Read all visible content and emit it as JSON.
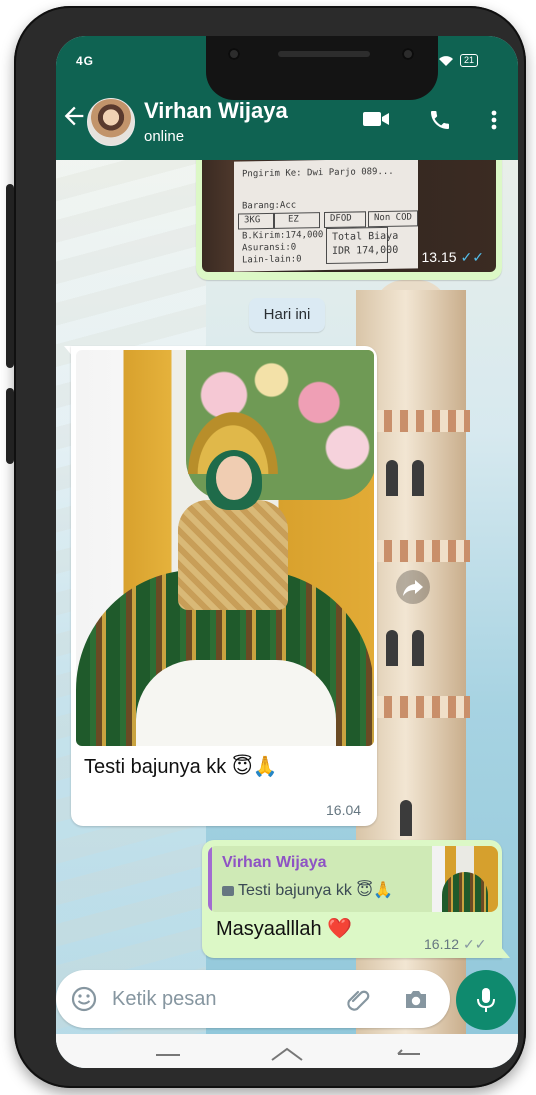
{
  "status_bar": {
    "left": "4G",
    "battery": "21"
  },
  "header": {
    "contact_name": "Virhan Wijaya",
    "contact_status": "online",
    "icons": [
      "back-arrow-icon",
      "video-call-icon",
      "phone-icon",
      "more-vert-icon"
    ]
  },
  "receipt_message": {
    "lines": [
      "Pngirim Ke: Dwi Parjo 089...",
      "Barang:Acc",
      "3KG",
      "EZ",
      "DFOD",
      "Non COD",
      "B.Kirim:174,000",
      "Asuransi:0",
      "Lain-lain:0",
      "Total Biaya",
      "IDR 174,000"
    ],
    "time": "13.15"
  },
  "date_chip": "Hari ini",
  "incoming_message": {
    "caption": "Testi bajunya kk",
    "caption_emoji": "😇🙏",
    "time": "16.04"
  },
  "outgoing_message": {
    "reply_name": "Virhan Wijaya",
    "reply_text": "Testi bajunya kk",
    "reply_emoji": "😇🙏",
    "text": "Masyaalllah",
    "text_emoji": "❤️",
    "time": "16.12"
  },
  "input": {
    "placeholder": "Ketik pesan"
  },
  "colors": {
    "header": "#0f6352",
    "outgoing_bubble": "#dcf8c6",
    "incoming_bubble": "#ffffff",
    "mic_button": "#0f8a6e",
    "read_ticks": "#53bdeb"
  }
}
